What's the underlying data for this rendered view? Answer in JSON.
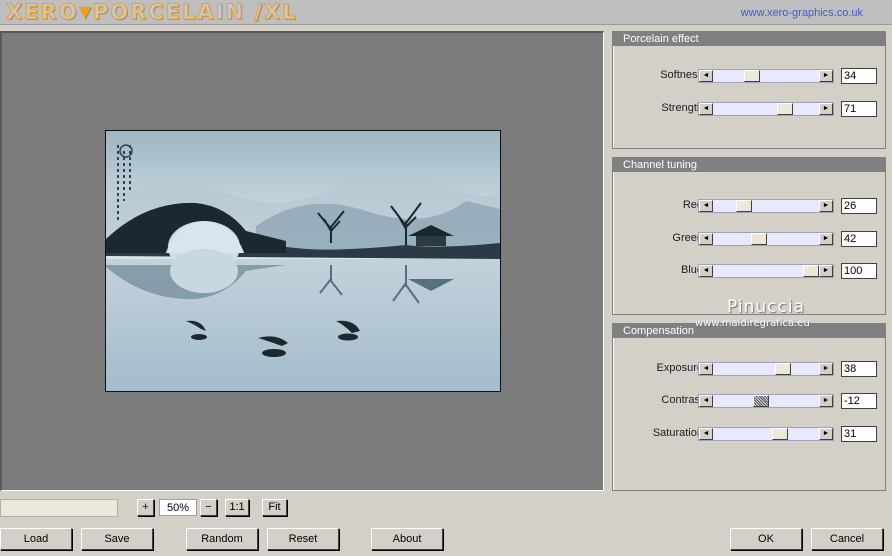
{
  "header": {
    "logo_text": "XERO",
    "logo_triangle": "▼",
    "logo_text2": "PORCELAIN /XL",
    "url": "www.xero-graphics.co.uk"
  },
  "panels": {
    "porcelain": {
      "title": "Porcelain effect",
      "sliders": [
        {
          "label": "Softness",
          "value": "34",
          "fraction": 0.34
        },
        {
          "label": "Strength",
          "value": "71",
          "fraction": 0.71
        }
      ]
    },
    "channel": {
      "title": "Channel tuning",
      "sliders": [
        {
          "label": "Red",
          "value": "26",
          "fraction": 0.26
        },
        {
          "label": "Green",
          "value": "42",
          "fraction": 0.42
        },
        {
          "label": "Blue",
          "value": "100",
          "fraction": 1.0
        }
      ]
    },
    "compensation": {
      "title": "Compensation",
      "sliders": [
        {
          "label": "Exposure",
          "value": "38",
          "fraction": 0.69
        },
        {
          "label": "Contrast",
          "value": "-12",
          "fraction": 0.44
        },
        {
          "label": "Saturation",
          "value": "31",
          "fraction": 0.65
        }
      ]
    }
  },
  "watermark": {
    "name": "Pinuccia",
    "site": "www.maidiregrafica.eu"
  },
  "zoom": {
    "plus": "+",
    "value": "50%",
    "minus": "−",
    "one_to_one": "1:1",
    "fit": "Fit"
  },
  "buttons": {
    "load": "Load",
    "save": "Save",
    "random": "Random",
    "reset": "Reset",
    "about": "About",
    "ok": "OK",
    "cancel": "Cancel"
  },
  "arrows": {
    "left": "◄",
    "right": "►"
  },
  "colors": {
    "panel_title_bg": "#808080",
    "track": "#e8e8ff",
    "preview_bg": "#7b7b7b",
    "url": "#3a5fd0",
    "logo_accent": "#f0a020"
  }
}
